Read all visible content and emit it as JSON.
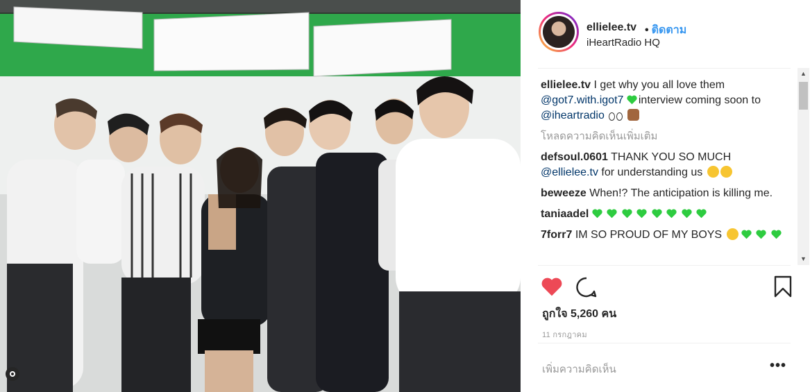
{
  "post": {
    "username": "ellielee.tv",
    "separator": "•",
    "follow_label": "ติดตาม",
    "location": "iHeartRadio HQ",
    "caption": {
      "username": "ellielee.tv",
      "text_before": "I get why you all love them",
      "mention1": "@got7.with.igot7",
      "text_middle": "interview coming soon to",
      "mention2": "@iheartradio"
    },
    "load_more": "โหลดความคิดเห็นเพิ่มเติม",
    "comments": [
      {
        "username": "defsoul.0601",
        "text": "THANK YOU SO MUCH",
        "mention": "@ellielee.tv",
        "text2": "for understanding us"
      },
      {
        "username": "beweeze",
        "text": "When!? The anticipation is killing me."
      },
      {
        "username": "taniaadel",
        "text": ""
      },
      {
        "username": "7forr7",
        "text": "IM SO PROUD OF MY BOYS"
      }
    ],
    "likes": "ถูกใจ 5,260 คน",
    "date": "11 กรกฎาคม",
    "add_comment_placeholder": "เพิ่มความคิดเห็น",
    "more_label": "•••"
  },
  "icons": {
    "like": "heart-icon",
    "comment": "comment-icon",
    "save": "bookmark-icon",
    "more": "more-options-icon",
    "green_heart": "green-heart-emoji",
    "eyes": "eyes-emoji",
    "see_no_evil": "see-no-evil-monkey-emoji",
    "grin": "grinning-emoji",
    "wink": "winking-emoji",
    "crying": "crying-emoji"
  },
  "colors": {
    "like_red": "#ed4956",
    "link_blue": "#3897f0",
    "mention_navy": "#003569",
    "muted_gray": "#999999",
    "green_heart": "#2ecc40"
  }
}
